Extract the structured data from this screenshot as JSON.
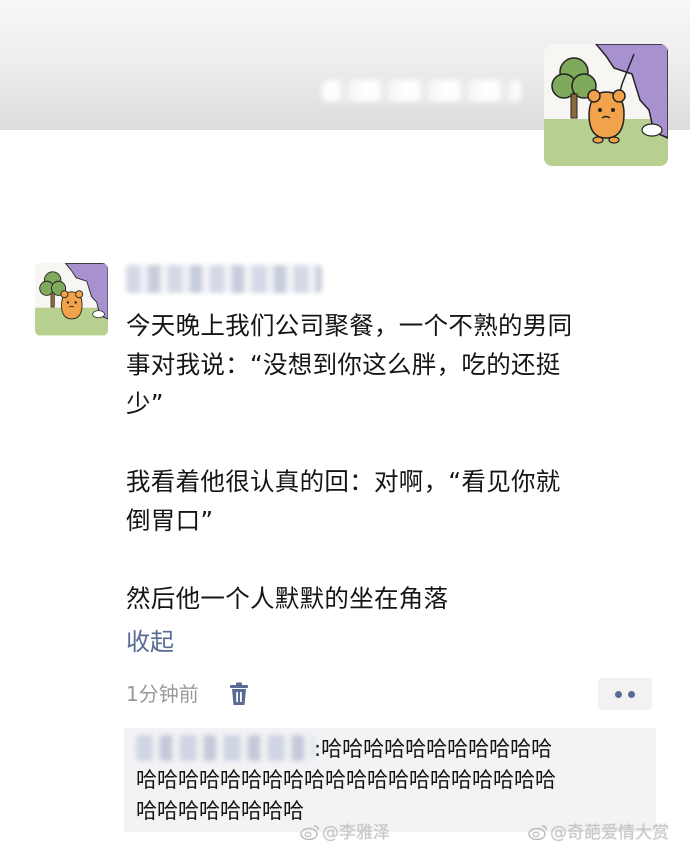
{
  "post": {
    "paragraphs": [
      "今天晚上我们公司聚餐，一个不熟的男同",
      "事对我说：“没想到你这么胖，吃的还挺",
      "少”",
      "",
      "我看着他很认真的回：对啊，“看见你就",
      "倒胃口”",
      "",
      "然后他一个人默默的坐在角落"
    ],
    "collapse_label": "收起",
    "time_label": "1分钟前"
  },
  "comment": {
    "text_line1": ":哈哈哈哈哈哈哈哈哈哈哈",
    "text_line2": "哈哈哈哈哈哈哈哈哈哈哈哈哈哈哈哈哈哈哈哈",
    "text_line3": "哈哈哈哈哈哈哈哈"
  },
  "watermarks": {
    "left": "@李雅泽",
    "right": "@奇葩爱情大赏"
  },
  "icons": {
    "delete": "trash-icon",
    "more": "more-dots-icon",
    "weibo": "weibo-logo-icon"
  },
  "colors": {
    "link": "#576b95",
    "meta": "#9a9a9a",
    "comment_bg": "#f3f3f5"
  }
}
